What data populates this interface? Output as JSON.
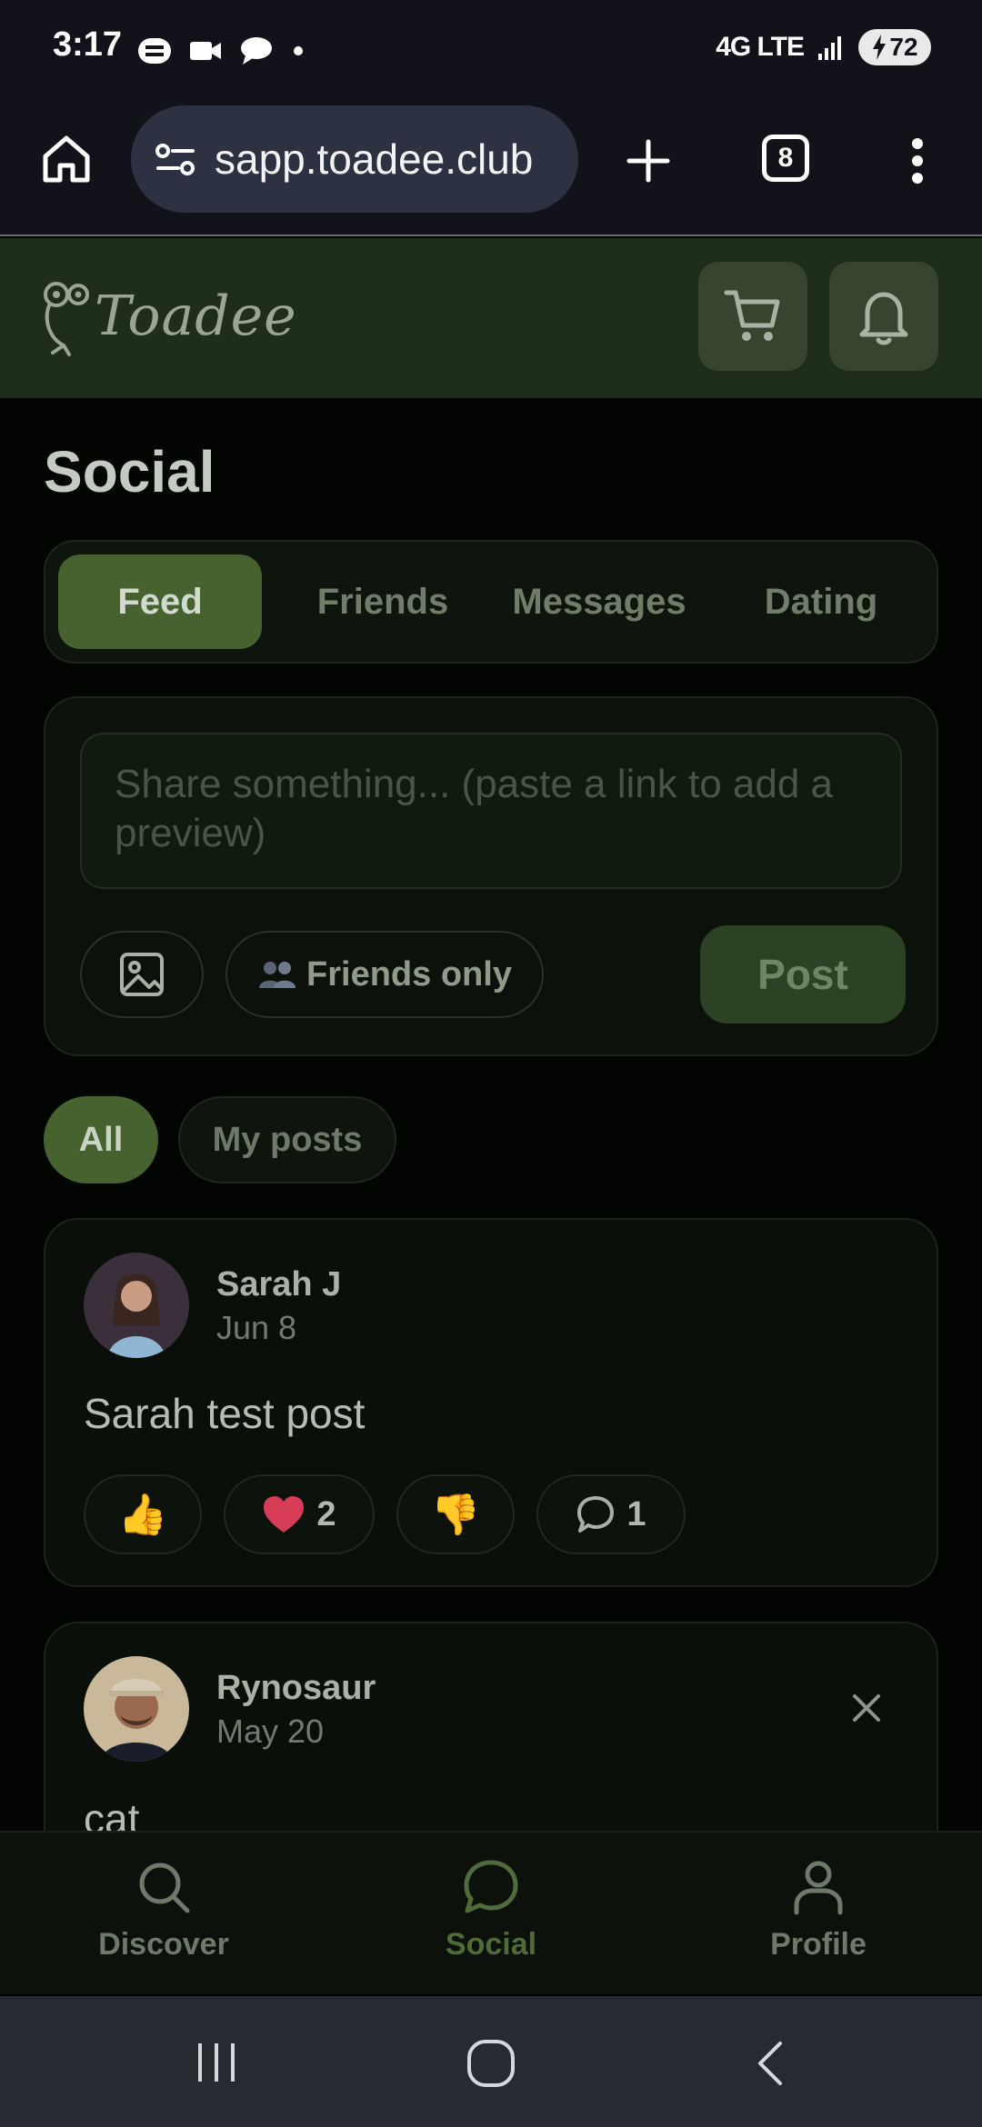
{
  "status_bar": {
    "time": "3:17",
    "network": "4G LTE",
    "battery": "72"
  },
  "browser": {
    "url": "sapp.toadee.club",
    "tab_count": "8"
  },
  "app": {
    "logo_text": "Toadee"
  },
  "page": {
    "title": "Social"
  },
  "tabs": [
    {
      "label": "Feed",
      "active": true
    },
    {
      "label": "Friends",
      "active": false
    },
    {
      "label": "Messages",
      "active": false
    },
    {
      "label": "Dating",
      "active": false
    }
  ],
  "composer": {
    "placeholder": "Share something... (paste a link to add a preview)",
    "audience_label": "Friends only",
    "post_label": "Post"
  },
  "filters": [
    {
      "label": "All",
      "active": true
    },
    {
      "label": "My posts",
      "active": false
    }
  ],
  "posts": [
    {
      "author": "Sarah J",
      "date": "Jun 8",
      "text": "Sarah test post",
      "reactions": {
        "like_count": "",
        "heart_count": "2",
        "dislike_count": "",
        "comment_count": "1"
      }
    },
    {
      "author": "Rynosaur",
      "date": "May 20",
      "text": "cat"
    }
  ],
  "bottom_nav": [
    {
      "label": "Discover",
      "active": false
    },
    {
      "label": "Social",
      "active": true
    },
    {
      "label": "Profile",
      "active": false
    }
  ],
  "colors": {
    "brand_green": "#45622f",
    "header_bg": "#1f2d1b",
    "active_nav": "#4f6b3a"
  }
}
